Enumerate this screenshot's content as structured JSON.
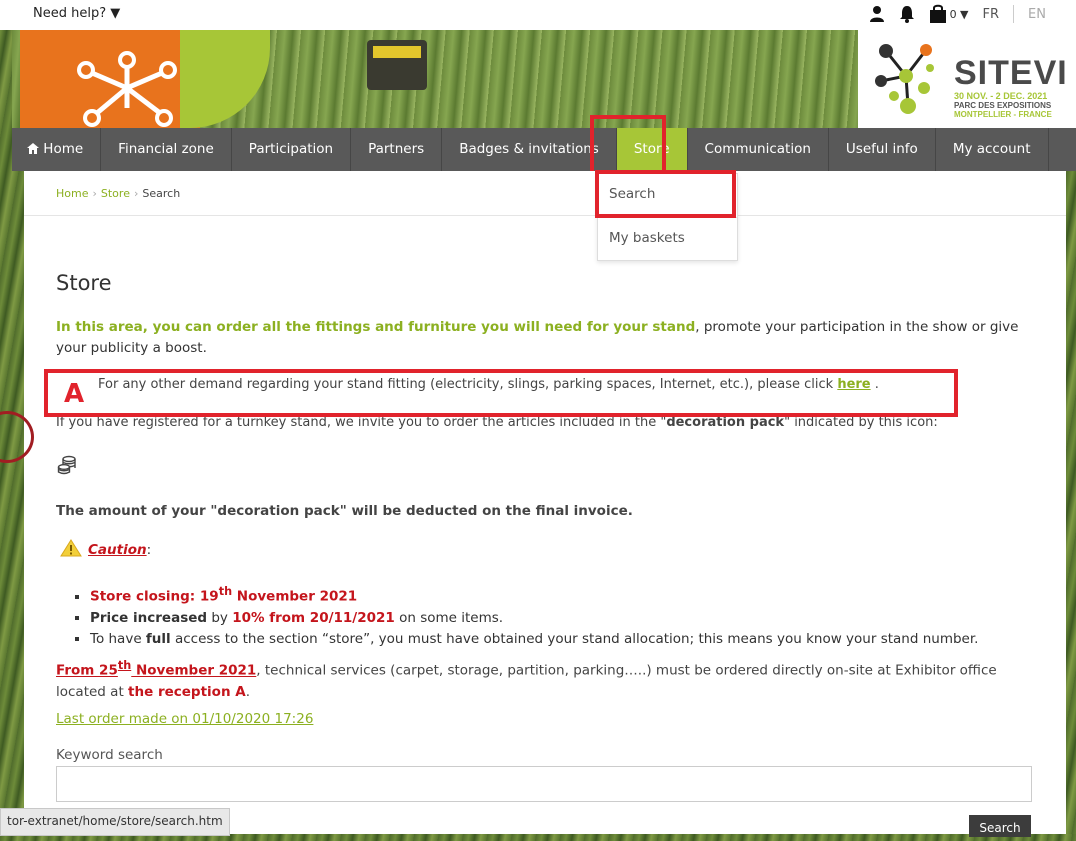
{
  "topbar": {
    "need_help": "Need help? ▼",
    "cart_count": "0 ▼",
    "lang_fr": "FR",
    "lang_en": "EN"
  },
  "logo": {
    "name": "SITEVI",
    "dates": "30 NOV. - 2 DEC. 2021",
    "venue": "PARC DES EXPOSITIONS",
    "city": "MONTPELLIER - FRANCE"
  },
  "nav": {
    "items": [
      "Home",
      "Financial zone",
      "Participation",
      "Partners",
      "Badges & invitations",
      "Store",
      "Communication",
      "Useful info",
      "My account"
    ],
    "active": "Store"
  },
  "dropdown": {
    "items": [
      "Search",
      "My baskets"
    ]
  },
  "breadcrumb": {
    "home": "Home",
    "store": "Store",
    "current": "Search"
  },
  "page": {
    "title": "Store",
    "intro_bold": "In this area, you can order all the fittings and furniture you will need for your stand",
    "intro_rest": ", promote your participation in the show or give your publicity a boost.",
    "annotation_letter": "A",
    "other_demand": "For any other demand regarding your stand fitting (electricity, slings, parking spaces, Internet, etc.), please click",
    "here": "here",
    "turnkey_pre": "If you have registered for a turnkey stand, we invite you to order the articles included in the \"",
    "turnkey_bold": "decoration pack",
    "turnkey_post": "\" indicated by this icon:",
    "deduct": "The amount of your \"decoration pack\" will be deducted on the final invoice.",
    "caution": "Caution",
    "bullet1_a": "Store closing: 19",
    "bullet1_sup": "th",
    "bullet1_b": " November 2021",
    "bullet2_bold": "Price increased",
    "bullet2_mid": " by ",
    "bullet2_red": "10% from 20/11/2021",
    "bullet2_rest": " on some items.",
    "bullet3_pre": "To have ",
    "bullet3_bold": "full",
    "bullet3_rest": " access to the section “store”, you must have obtained your stand allocation; this means you know your stand number.",
    "from_a": "From 25",
    "from_sup": "th",
    "from_b": " November 2021",
    "from_rest": ", technical services (carpet, storage, partition, parking…..) must be ordered directly on-site at Exhibitor office located at ",
    "from_red": "the reception A",
    "from_end": ".",
    "last_order": "Last order made on 01/10/2020 17:26",
    "keyword_label": "Keyword search",
    "search_button": "Search"
  },
  "status_url": "tor-extranet/home/store/search.htm",
  "colors": {
    "accent_green": "#a7c637",
    "nav_bg": "#595959",
    "highlight_red": "#e1232c",
    "text_red": "#c4151c"
  }
}
